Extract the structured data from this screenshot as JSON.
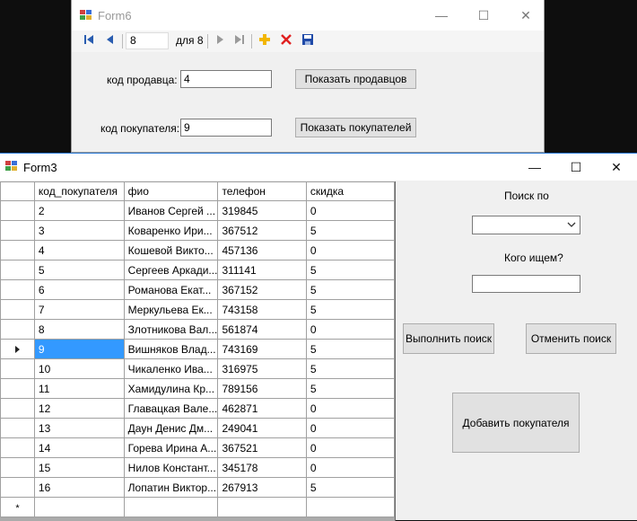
{
  "form6": {
    "title": "Form6",
    "window_controls": {
      "minimize": "—",
      "maximize": "☐",
      "close": "✕"
    },
    "navigator": {
      "position": "8",
      "count_label": "для 8",
      "icons": [
        "first-icon",
        "prev-icon",
        "next-icon",
        "last-icon",
        "add-icon",
        "delete-icon",
        "save-icon"
      ]
    },
    "seller_label": "код продавца:",
    "seller_value": "4",
    "show_sellers_button": "Показать продавцов",
    "buyer_label": "код покупателя:",
    "buyer_value": "9",
    "show_buyers_button": "Показать покупателей"
  },
  "form3": {
    "title": "Form3",
    "window_controls": {
      "minimize": "—",
      "maximize": "☐",
      "close": "✕"
    },
    "grid": {
      "columns": [
        "код_покупателя",
        "фио",
        "телефон",
        "скидка"
      ],
      "selected_index": 7,
      "new_row_marker": "*",
      "rows": [
        [
          "2",
          "Иванов Сергей ...",
          "319845",
          "0"
        ],
        [
          "3",
          "Коваренко Ири...",
          "367512",
          "5"
        ],
        [
          "4",
          "Кошевой Викто...",
          "457136",
          "0"
        ],
        [
          "5",
          "Сергеев Аркади...",
          "311141",
          "5"
        ],
        [
          "6",
          "Романова Екат...",
          "367152",
          "5"
        ],
        [
          "7",
          "Меркульева Ек...",
          "743158",
          "5"
        ],
        [
          "8",
          "Злотникова Вал...",
          "561874",
          "0"
        ],
        [
          "9",
          "Вишняков Влад...",
          "743169",
          "5"
        ],
        [
          "10",
          "Чикаленко Ива...",
          "316975",
          "5"
        ],
        [
          "11",
          "Хамидулина Кр...",
          "789156",
          "5"
        ],
        [
          "12",
          "Главацкая Вале...",
          "462871",
          "0"
        ],
        [
          "13",
          "Даун Денис Дм...",
          "249041",
          "0"
        ],
        [
          "14",
          "Горева Ирина А...",
          "367521",
          "0"
        ],
        [
          "15",
          "Нилов Констант...",
          "345178",
          "0"
        ],
        [
          "16",
          "Лопатин Виктор...",
          "267913",
          "5"
        ]
      ]
    },
    "search_by_label": "Поиск по",
    "search_by_value": "",
    "who_label": "Кого ищем?",
    "who_value": "",
    "run_search_button": "Выполнить поиск",
    "cancel_search_button": "Отменить поиск",
    "add_buyer_button": "Добавить покупателя"
  }
}
